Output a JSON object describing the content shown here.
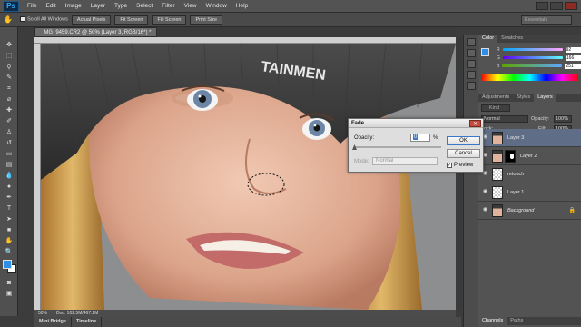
{
  "app": {
    "logo": "Ps"
  },
  "menu": [
    "File",
    "Edit",
    "Image",
    "Layer",
    "Type",
    "Select",
    "Filter",
    "View",
    "Window",
    "Help"
  ],
  "options": {
    "checkbox_label": "Scroll All Windows",
    "buttons": [
      "Actual Pixels",
      "Fit Screen",
      "Fill Screen",
      "Print Size"
    ],
    "workspace": "Essentials"
  },
  "document": {
    "tab_title": "_MG_9459.CR2 @ 50% (Layer 3, RGB/16*) *",
    "zoom": "50%",
    "doc_info": "Doc: 102.5M/467.2M"
  },
  "bottom_tabs": [
    "Mini Bridge",
    "Timeline"
  ],
  "color_panel": {
    "tabs": [
      "Color",
      "Swatches"
    ],
    "channels": [
      {
        "label": "R",
        "value": "92"
      },
      {
        "label": "G",
        "value": "166"
      },
      {
        "label": "B",
        "value": "251"
      }
    ]
  },
  "layers_panel": {
    "tabs": [
      "Adjustments",
      "Styles",
      "Layers"
    ],
    "kind": "Kind",
    "blend_mode": "Normal",
    "opacity_label": "Opacity:",
    "opacity_value": "100%",
    "lock_label": "Lock:",
    "fill_label": "Fill:",
    "fill_value": "100%",
    "layers": [
      {
        "name": "Layer 3",
        "selected": true
      },
      {
        "name": "Layer 2",
        "selected": false
      },
      {
        "name": "retouch",
        "selected": false
      },
      {
        "name": "Layer 1",
        "selected": false
      },
      {
        "name": "Background",
        "selected": false
      }
    ],
    "bottom_tabs": [
      "Channels",
      "Paths"
    ]
  },
  "fade_dialog": {
    "title": "Fade",
    "opacity_label": "Opacity:",
    "opacity_value": "0",
    "opacity_unit": "%",
    "opacity_fraction": 0.0,
    "mode_label": "Mode:",
    "mode_value": "Normal",
    "ok": "OK",
    "cancel": "Cancel",
    "preview_label": "Preview"
  },
  "colors": {
    "accent": "#2f8ee8",
    "layer_selected": "#5f6d86",
    "foreground": "#2f8ee8",
    "background": "#ffffff"
  },
  "hat_text": "TAINMEN"
}
